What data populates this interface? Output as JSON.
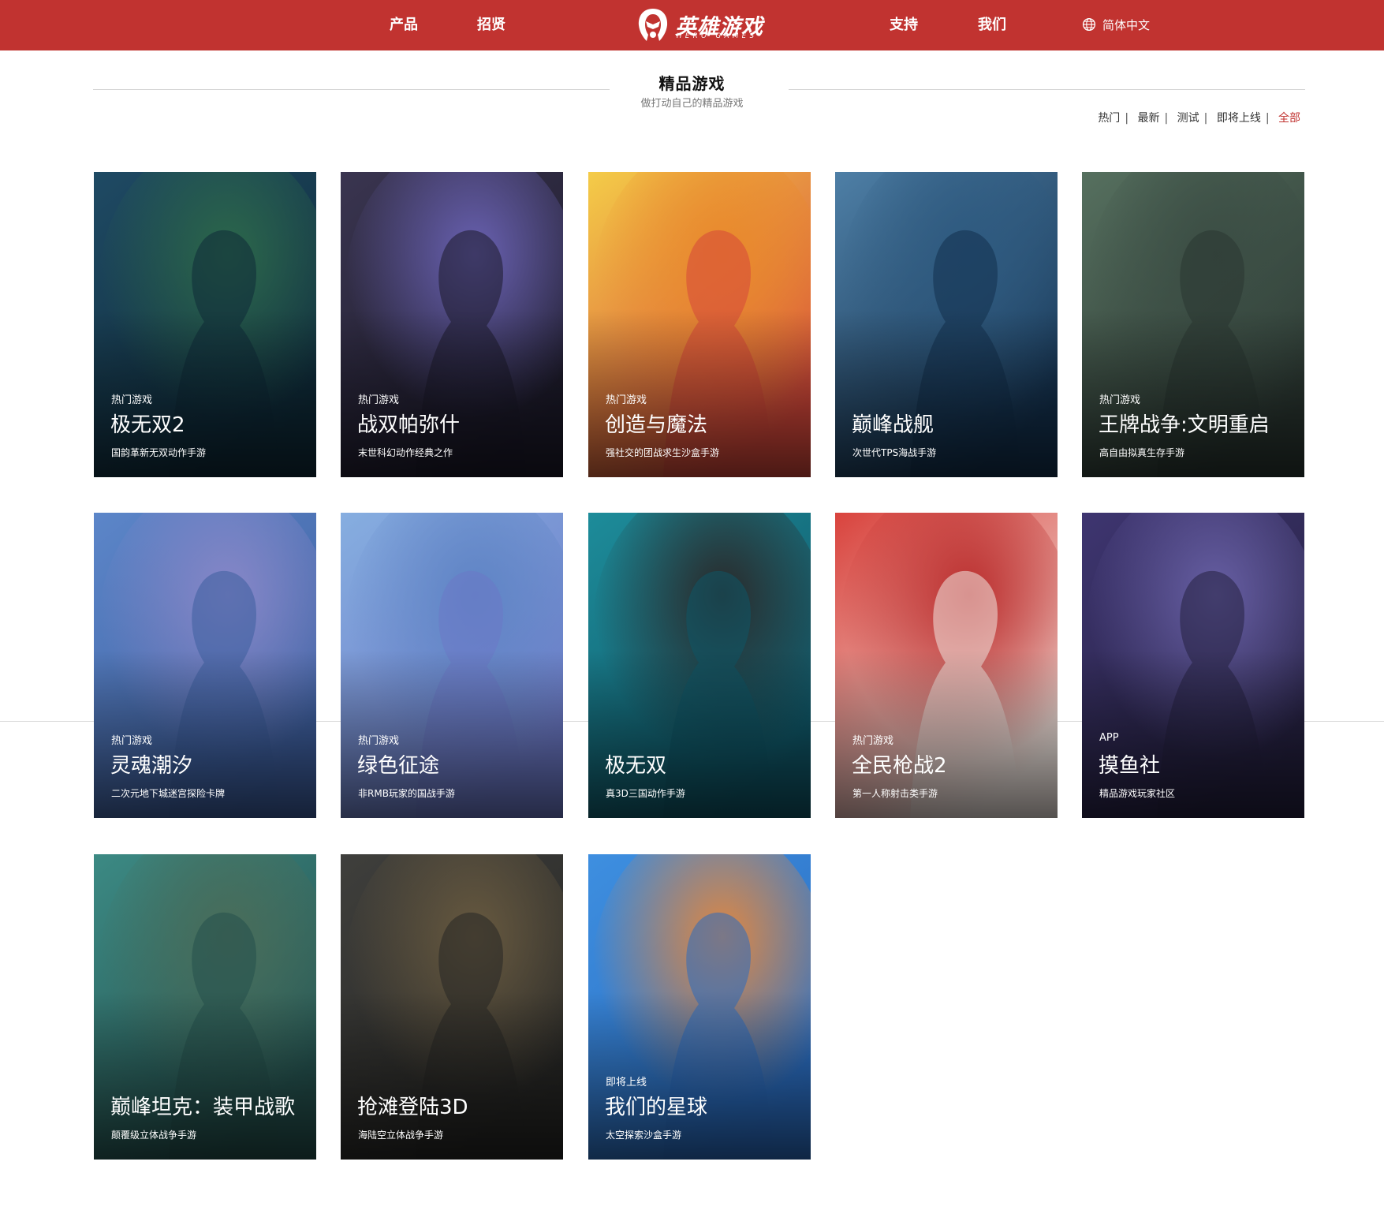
{
  "nav": {
    "left": [
      "产品",
      "招贤"
    ],
    "right": [
      "支持",
      "我们"
    ],
    "logo": {
      "name": "英雄游戏",
      "sub": "HERO GAMES"
    },
    "language": {
      "label": "简体中文",
      "icon": "globe-icon"
    }
  },
  "section": {
    "title": "精品游戏",
    "subtitle": "做打动自己的精品游戏",
    "filters": [
      {
        "label": "热门",
        "active": false
      },
      {
        "label": "最新",
        "active": false
      },
      {
        "label": "测试",
        "active": false
      },
      {
        "label": "即将上线",
        "active": false
      },
      {
        "label": "全部",
        "active": true
      }
    ]
  },
  "games": [
    {
      "tag": "热门游戏",
      "name": "极无双2",
      "desc": "国韵革新无双动作手游",
      "colors": [
        "#1f4a64",
        "#2d6a4a",
        "#0e2a38"
      ]
    },
    {
      "tag": "热门游戏",
      "name": "战双帕弥什",
      "desc": "末世科幻动作经典之作",
      "colors": [
        "#3a3550",
        "#6c64b8",
        "#1c1a2a"
      ]
    },
    {
      "tag": "热门游戏",
      "name": "创造与魔法",
      "desc": "强社交的团战求生沙盒手游",
      "colors": [
        "#f4cc48",
        "#e9892a",
        "#d6473a"
      ]
    },
    {
      "tag": "",
      "name": "巅峰战舰",
      "desc": "次世代TPS海战手游",
      "colors": [
        "#4e7fa6",
        "#2e5a80",
        "#13304d"
      ]
    },
    {
      "tag": "热门游戏",
      "name": "王牌战争:文明重启",
      "desc": "高自由拟真生存手游",
      "colors": [
        "#56705f",
        "#3b4d44",
        "#2a3631"
      ]
    },
    {
      "tag": "热门游戏",
      "name": "灵魂潮汐",
      "desc": "二次元地下城迷宫探险卡牌",
      "colors": [
        "#5c86c9",
        "#8b88c9",
        "#3d5e9e"
      ]
    },
    {
      "tag": "热门游戏",
      "name": "绿色征途",
      "desc": "非RMB玩家的国战手游",
      "colors": [
        "#86aee0",
        "#5d83c4",
        "#6b78c6"
      ]
    },
    {
      "tag": "",
      "name": "极无双",
      "desc": "真3D三国动作手游",
      "colors": [
        "#1d8c9a",
        "#2b2626",
        "#0f5566"
      ]
    },
    {
      "tag": "热门游戏",
      "name": "全民枪战2",
      "desc": "第一人称射击类手游",
      "colors": [
        "#d9433d",
        "#b82a2a",
        "#f1e6e0"
      ]
    },
    {
      "tag": "APP",
      "name": "摸鱼社",
      "desc": "精品游戏玩家社区",
      "colors": [
        "#3e3570",
        "#6a62a8",
        "#24203f"
      ]
    },
    {
      "tag": "",
      "name": "巅峰坦克：装甲战歌",
      "desc": "颠覆级立体战争手游",
      "colors": [
        "#3c8a84",
        "#4b6c58",
        "#24504d"
      ]
    },
    {
      "tag": "",
      "name": "抢滩登陆3D",
      "desc": "海陆空立体战争手游",
      "colors": [
        "#3f3f3c",
        "#6a5b40",
        "#262624"
      ]
    },
    {
      "tag": "即将上线",
      "name": "我们的星球",
      "desc": "太空探索沙盒手游",
      "colors": [
        "#3e8fe0",
        "#e8873a",
        "#2a6cc0"
      ]
    }
  ]
}
